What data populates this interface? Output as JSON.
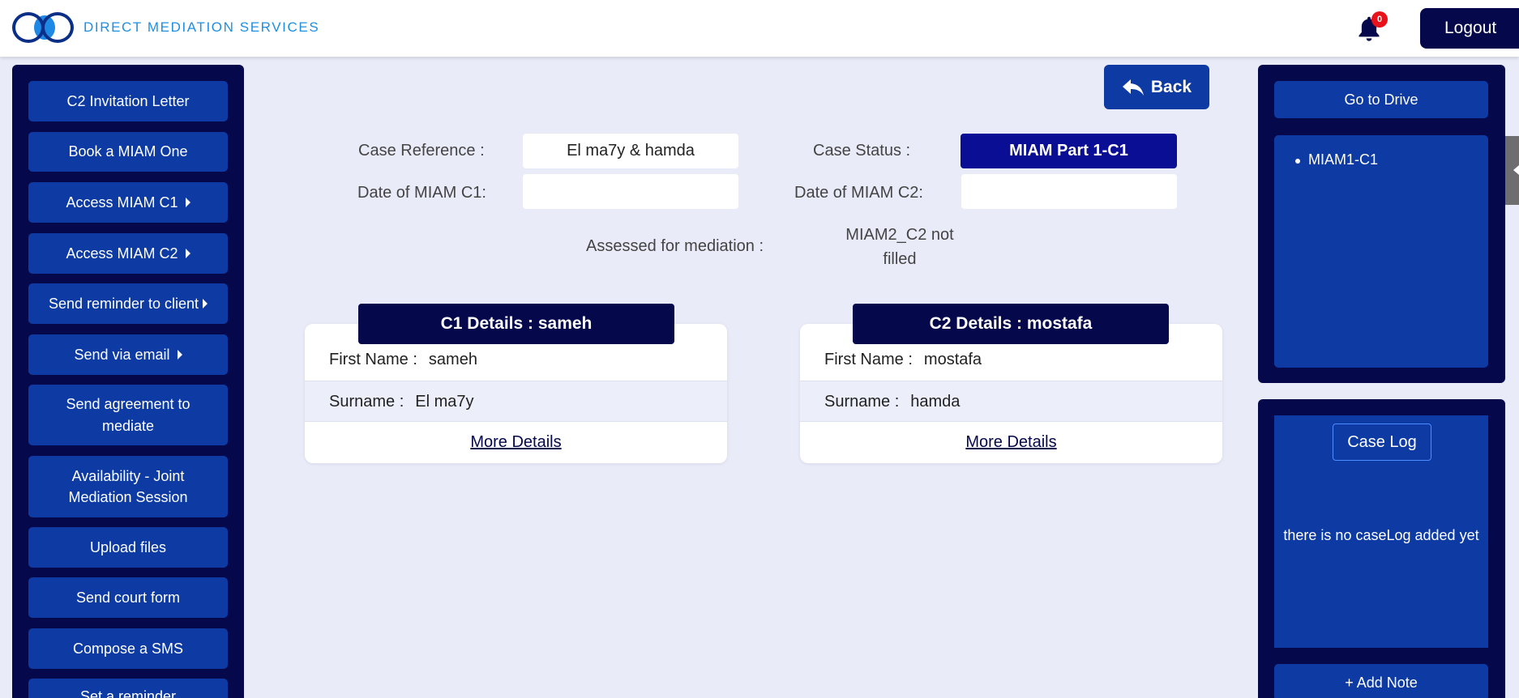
{
  "header": {
    "brand": "DIRECT MEDIATION SERVICES",
    "notification_count": "0",
    "logout_label": "Logout"
  },
  "sidebar": {
    "items": [
      {
        "label": "C2 Invitation Letter",
        "has_caret": false
      },
      {
        "label": "Book a MIAM One",
        "has_caret": false
      },
      {
        "label": "Access MIAM C1",
        "has_caret": true
      },
      {
        "label": "Access MIAM C2",
        "has_caret": true
      },
      {
        "label": "Send reminder to client",
        "has_caret": true
      },
      {
        "label": "Send via email",
        "has_caret": true
      },
      {
        "label": "Send agreement to mediate",
        "has_caret": false
      },
      {
        "label": "Availability - Joint Mediation Session",
        "has_caret": false
      },
      {
        "label": "Upload files",
        "has_caret": false
      },
      {
        "label": "Send court form",
        "has_caret": false
      },
      {
        "label": "Compose a SMS",
        "has_caret": false
      },
      {
        "label": "Set a reminder",
        "has_caret": false
      }
    ]
  },
  "main": {
    "back_label": "Back",
    "case_reference_label": "Case Reference :",
    "case_reference_value": "El ma7y & hamda",
    "case_status_label": "Case Status :",
    "case_status_value": "MIAM Part 1-C1",
    "date_c1_label": "Date of MIAM C1:",
    "date_c1_value": "",
    "date_c2_label": "Date of MIAM C2:",
    "date_c2_value": "",
    "assessed_label": "Assessed for mediation :",
    "assessed_value": "MIAM2_C2 not filled"
  },
  "clients": [
    {
      "header": "C1 Details : sameh",
      "first_name_label": "First Name :",
      "first_name": "sameh",
      "surname_label": "Surname :",
      "surname": "El ma7y",
      "more_label": "More Details"
    },
    {
      "header": "C2 Details : mostafa",
      "first_name_label": "First Name :",
      "first_name": "mostafa",
      "surname_label": "Surname :",
      "surname": "hamda",
      "more_label": "More Details"
    }
  ],
  "drive": {
    "button_label": "Go to Drive",
    "items": [
      "MIAM1-C1"
    ]
  },
  "case_log": {
    "button_label": "Case Log",
    "empty_text": "there is no caseLog added yet",
    "add_note_label": "+ Add Note"
  },
  "colors": {
    "navy": "#05084a",
    "button_blue": "#0d3aa3",
    "status_blue": "#0a0e94",
    "brand_blue": "#1e8fe0",
    "badge_red": "#e8121b",
    "page_bg": "#e9ebf8"
  },
  "icons": {
    "bell": "bell-icon",
    "back": "reply-arrow-icon",
    "caret": "caret-right-icon",
    "logo": "two-rings-logo"
  }
}
